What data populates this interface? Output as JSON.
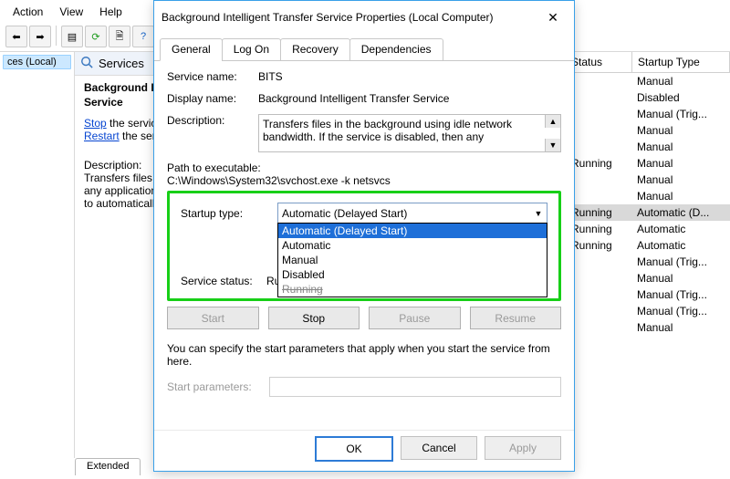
{
  "window": {
    "menus": [
      "Action",
      "View",
      "Help"
    ],
    "tree_node": "ces (Local)",
    "center_header": "Services",
    "service_title_l1": "Background Intelligent Transfer",
    "service_title_l2": "Service",
    "link_stop": "Stop",
    "link_stop_after": " the service",
    "link_restart": "Restart",
    "link_restart_after": " the service",
    "desc_head": "Description:",
    "desc_body": "Transfers files in the background using idle network bandwidth. If the service is disabled, then any applications that depend on BITS, such as Windows Update or MSN Explorer, will be unable to automatically download programs and other information.",
    "bottom_tab": "Extended"
  },
  "list": {
    "col_status": "Status",
    "col_startup": "Startup Type",
    "rows": [
      {
        "status": "",
        "startup": "Manual",
        "sel": false
      },
      {
        "status": "",
        "startup": "Disabled",
        "sel": false
      },
      {
        "status": "",
        "startup": "Manual (Trig...",
        "sel": false
      },
      {
        "status": "",
        "startup": "Manual",
        "sel": false
      },
      {
        "status": "",
        "startup": "Manual",
        "sel": false
      },
      {
        "status": "Running",
        "startup": "Manual",
        "sel": false
      },
      {
        "status": "",
        "startup": "Manual",
        "sel": false
      },
      {
        "status": "",
        "startup": "Manual",
        "sel": false
      },
      {
        "status": "Running",
        "startup": "Automatic (D...",
        "sel": true
      },
      {
        "status": "Running",
        "startup": "Automatic",
        "sel": false
      },
      {
        "status": "Running",
        "startup": "Automatic",
        "sel": false
      },
      {
        "status": "",
        "startup": "Manual (Trig...",
        "sel": false
      },
      {
        "status": "",
        "startup": "Manual",
        "sel": false
      },
      {
        "status": "",
        "startup": "Manual (Trig...",
        "sel": false
      },
      {
        "status": "",
        "startup": "Manual (Trig...",
        "sel": false
      },
      {
        "status": "",
        "startup": "Manual",
        "sel": false
      }
    ]
  },
  "dialog": {
    "title": "Background Intelligent Transfer Service Properties (Local Computer)",
    "tabs": [
      "General",
      "Log On",
      "Recovery",
      "Dependencies"
    ],
    "general": {
      "service_name_lbl": "Service name:",
      "service_name_val": "BITS",
      "display_name_lbl": "Display name:",
      "display_name_val": "Background Intelligent Transfer Service",
      "description_lbl": "Description:",
      "description_val": "Transfers files in the background using idle network bandwidth. If the service is disabled, then any",
      "path_lbl": "Path to executable:",
      "path_val": "C:\\Windows\\System32\\svchost.exe -k netsvcs",
      "startup_lbl": "Startup type:",
      "startup_value": "Automatic (Delayed Start)",
      "startup_options": [
        "Automatic (Delayed Start)",
        "Automatic",
        "Manual",
        "Disabled"
      ],
      "dropdown_last_visible": "Running",
      "status_lbl": "Service status:",
      "status_val": "Running",
      "hint": "You can specify the start parameters that apply when you start the service from here.",
      "start_params_lbl": "Start parameters:"
    },
    "buttons": {
      "start": "Start",
      "stop": "Stop",
      "pause": "Pause",
      "resume": "Resume",
      "ok": "OK",
      "cancel": "Cancel",
      "apply": "Apply"
    }
  }
}
